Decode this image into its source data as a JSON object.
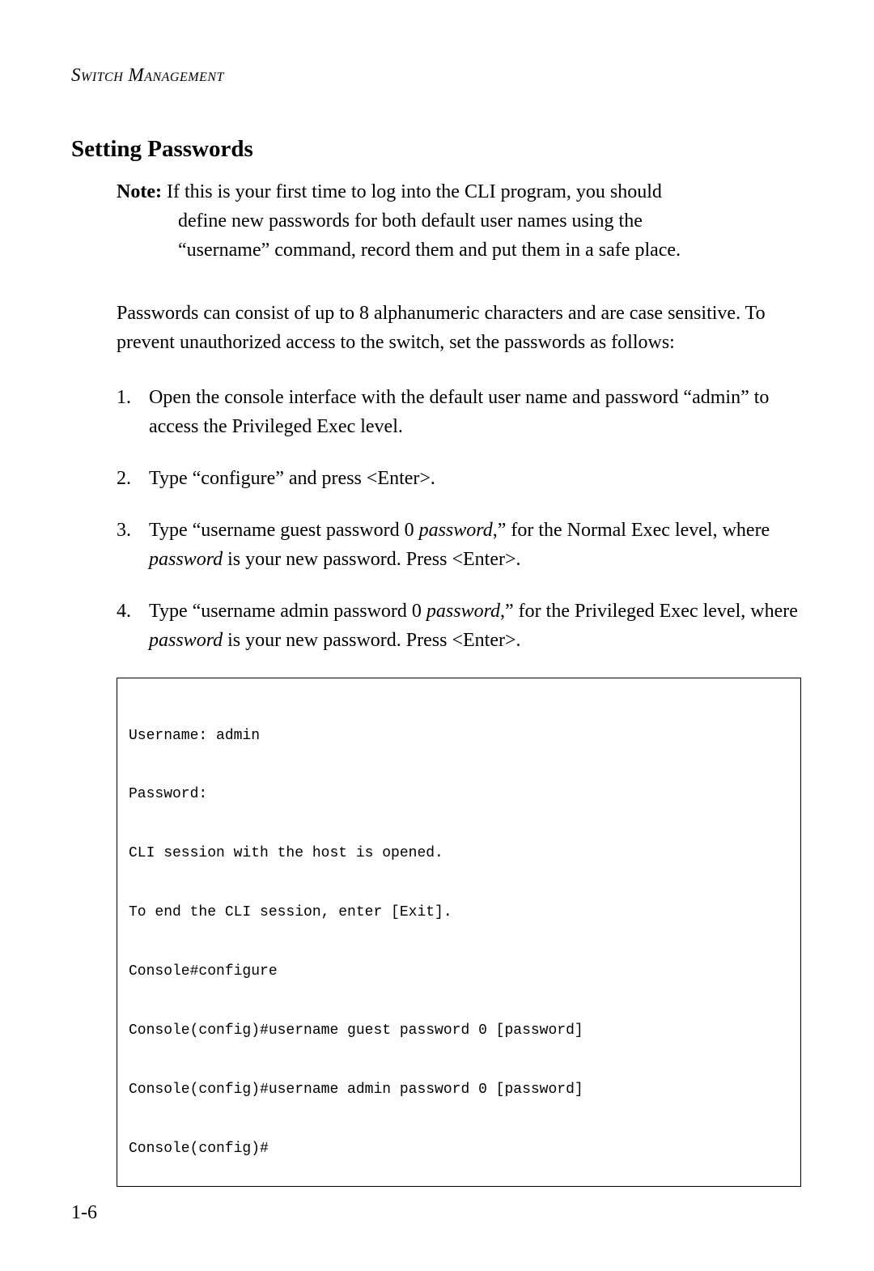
{
  "header": "Switch Management",
  "section_title": "Setting Passwords",
  "note": {
    "label": "Note:",
    "line1": "If this is your first time to log into the CLI program, you should",
    "line2": "define new passwords for both default user names using the",
    "line3": "“username” command, record them and put them in a safe place."
  },
  "body1": "Passwords can consist of up to 8 alphanumeric characters and are case sensitive. To prevent unauthorized access to the switch, set the passwords as follows:",
  "steps": [
    {
      "num": "1.",
      "text_before": "Open the console interface with the default user name and password “admin” to access the Privileged Exec level.",
      "italic": "",
      "text_after": ""
    },
    {
      "num": "2.",
      "text_before": "Type “configure” and press <Enter>.",
      "italic": "",
      "text_after": ""
    },
    {
      "num": "3.",
      "text_before": "Type “username guest password 0 ",
      "italic": "password",
      "text_mid": ",” for the Normal Exec level, where ",
      "italic2": "password",
      "text_after": " is your new password. Press <Enter>."
    },
    {
      "num": "4.",
      "text_before": "Type “username admin password 0 ",
      "italic": "password",
      "text_mid": ",” for the Privileged Exec level, where ",
      "italic2": "password",
      "text_after": " is your new password. Press <Enter>."
    }
  ],
  "code_lines": [
    "Username: admin",
    "Password:",
    "CLI session with the host is opened.",
    "To end the CLI session, enter [Exit].",
    "Console#configure",
    "Console(config)#username guest password 0 [password]",
    "Console(config)#username admin password 0 [password]",
    "Console(config)#"
  ],
  "page_number": "1-6"
}
